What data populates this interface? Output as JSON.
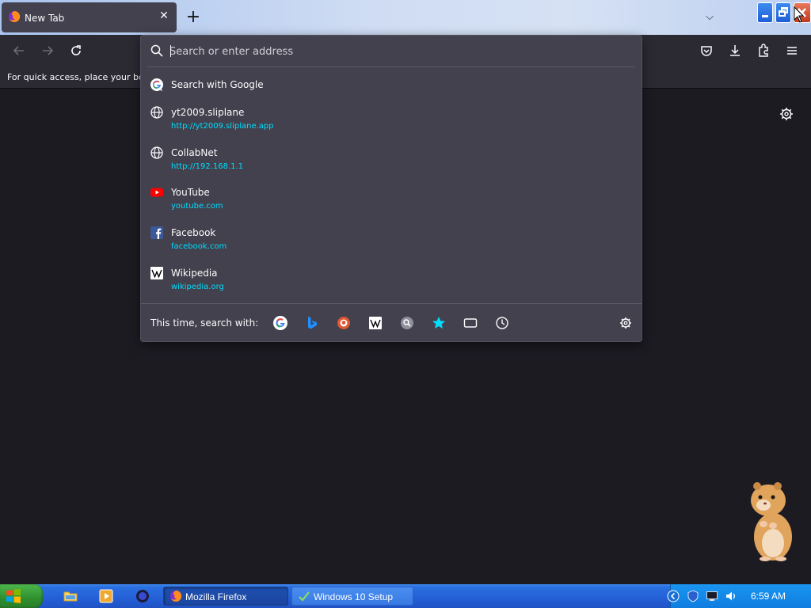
{
  "tab": {
    "title": "New Tab",
    "close": "✕",
    "new_tab": "+",
    "list_all": "⌵"
  },
  "urlbar": {
    "placeholder": "Search or enter address"
  },
  "bookmarks_bar": {
    "text": "For quick access, place your bookmarks here on the bookmarks toolbar."
  },
  "suggestions": [
    {
      "title": "Search with Google",
      "url": "",
      "icon": "google-icon"
    },
    {
      "title": "yt2009.sliplane",
      "url": "http://yt2009.sliplane.app",
      "icon": "globe-icon"
    },
    {
      "title": "CollabNet",
      "url": "http://192.168.1.1",
      "icon": "globe-icon"
    },
    {
      "title": "YouTube",
      "url": "youtube.com",
      "icon": "youtube-icon"
    },
    {
      "title": "Facebook",
      "url": "facebook.com",
      "icon": "facebook-icon"
    },
    {
      "title": "Wikipedia",
      "url": "wikipedia.org",
      "icon": "wikipedia-icon"
    }
  ],
  "search_with": {
    "label": "This time, search with:"
  },
  "taskbar": {
    "tasks": [
      {
        "label": "Mozilla Firefox",
        "active": true
      },
      {
        "label": "Windows 10 Setup",
        "active": false
      }
    ],
    "clock": "6:59 AM"
  },
  "colors": {
    "panel": "#42414d",
    "toolbar": "#2b2a33",
    "content": "#1c1b22",
    "link": "#00ddff",
    "taskbar": "#245fd6"
  }
}
